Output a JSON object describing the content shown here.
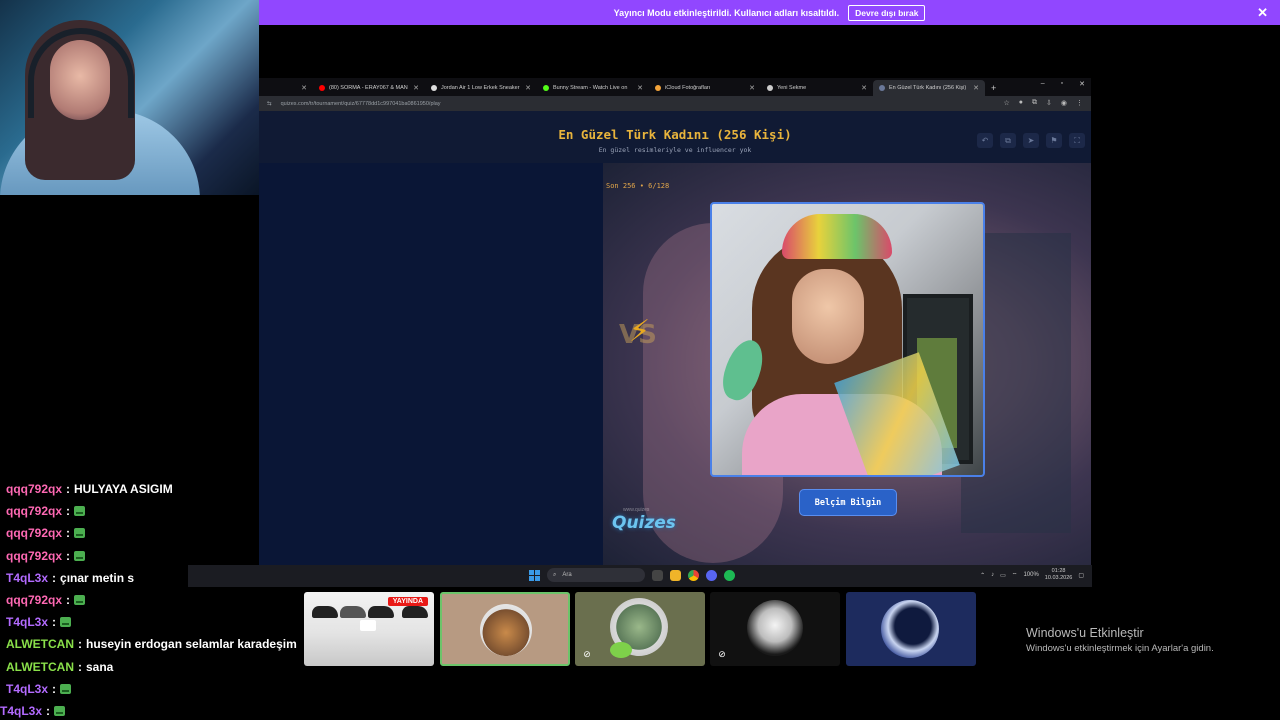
{
  "banner": {
    "message": "Yayıncı Modu etkinleştirildi. Kullanıcı adları kısaltıldı.",
    "button_label": "Devre dışı bırak",
    "close": "✕",
    "color": "#9147ff"
  },
  "browser": {
    "tabs": [
      {
        "label": "",
        "color": "#888888",
        "active": false
      },
      {
        "label": "(80) SORMA - ERAY067 & MAN",
        "color": "#ff0000",
        "active": false
      },
      {
        "label": "Jordan Air 1 Low Erkek Sneaker",
        "color": "#dddddd",
        "active": false
      },
      {
        "label": "Bunny Stream - Watch Live on",
        "color": "#53fc18",
        "active": false
      },
      {
        "label": "iCloud Fotoğrafları",
        "color": "#f2a33a",
        "active": false
      },
      {
        "label": "Yeni Sekme",
        "color": "#cccccc",
        "active": false
      },
      {
        "label": "En Güzel Türk Kadını (256 Kişi)",
        "color": "#6a7899",
        "active": true
      }
    ],
    "new_tab": "+",
    "window_controls": [
      "–",
      "▫",
      "✕"
    ],
    "url": "quizes.com/tr/tournament/quiz/67778dd1c997041ba0861950/play"
  },
  "quiz": {
    "title": "En Güzel Türk Kadını (256 Kişi)",
    "subtitle": "En güzel resimleriyle ve influencer yok",
    "round": "Son 256 • 6/128",
    "vs": "VS",
    "choice_label": "Belçim Bilgin",
    "logo_sub": "www.quizes",
    "logo": "Quizes",
    "tools": [
      "↶",
      "⧉",
      "➤",
      "⚑",
      "⛶"
    ]
  },
  "chat": [
    {
      "user": "qqq792qx",
      "color": "#ff69b4",
      "text": "HULYAYA ASIGIM",
      "emote": false
    },
    {
      "user": "qqq792qx",
      "color": "#ff69b4",
      "text": "",
      "emote": true
    },
    {
      "user": "qqq792qx",
      "color": "#ff69b4",
      "text": "",
      "emote": true
    },
    {
      "user": "qqq792qx",
      "color": "#ff69b4",
      "text": "",
      "emote": true
    },
    {
      "user": "T4qL3x",
      "color": "#b36bff",
      "text": "çınar metin s",
      "emote": false
    },
    {
      "user": "qqq792qx",
      "color": "#ff69b4",
      "text": "",
      "emote": true
    },
    {
      "user": "T4qL3x",
      "color": "#b36bff",
      "text": "",
      "emote": true
    },
    {
      "user": "ALWETCAN",
      "color": "#8ae04a",
      "text": "huseyin erdogan selamlar karadeşim",
      "emote": false
    },
    {
      "user": "ALWETCAN",
      "color": "#8ae04a",
      "text": "sana",
      "emote": false
    },
    {
      "user": "T4qL3x",
      "color": "#b36bff",
      "text": "",
      "emote": true
    },
    {
      "user": "T4qL3x",
      "color": "#b36bff",
      "text": "",
      "emote": true
    }
  ],
  "taskbar": {
    "search_placeholder": "Ara",
    "time": "01:28",
    "date": "10.03.2026",
    "battery": "100%"
  },
  "thumbnails": {
    "live_badge": "YAYINDA"
  },
  "watermark": {
    "title": "Windows'u Etkinleştir",
    "subtitle": "Windows'u etkinleştirmek için Ayarlar'a gidin."
  }
}
